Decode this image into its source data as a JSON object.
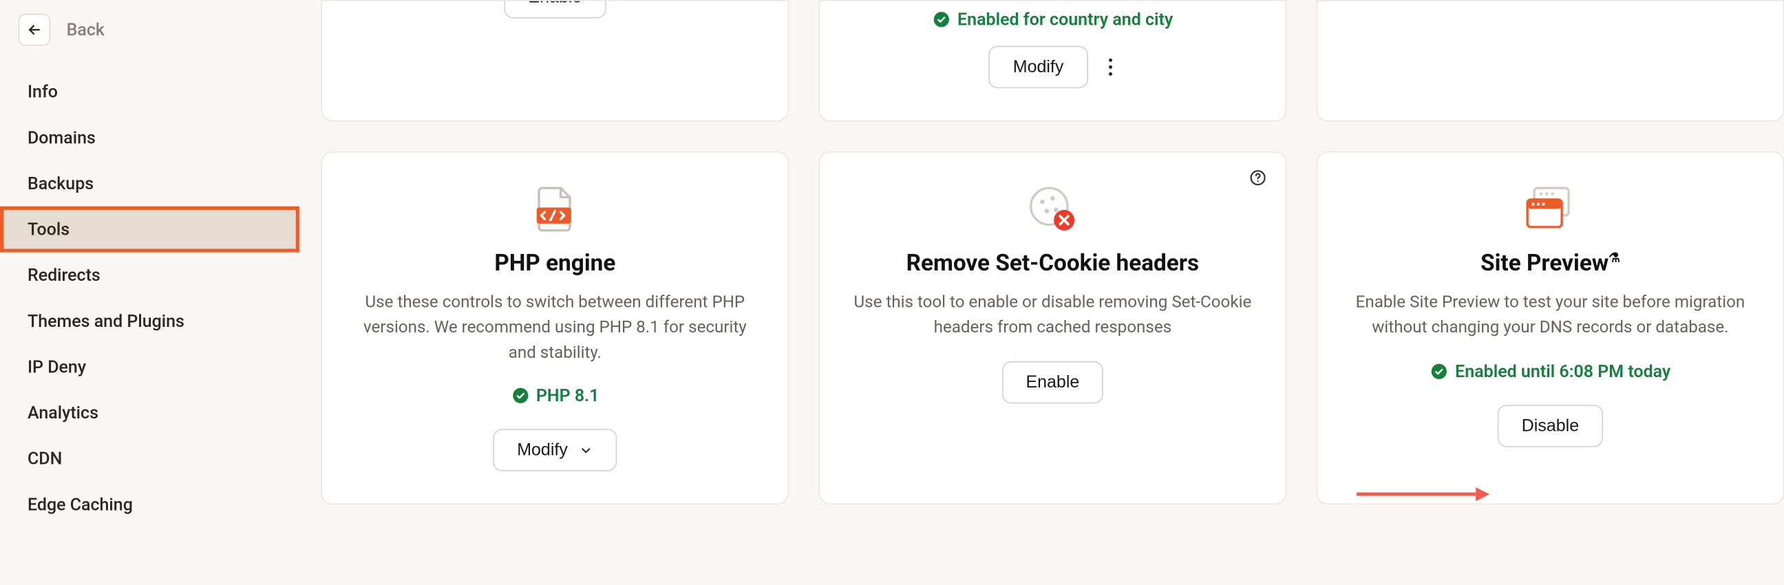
{
  "back_label": "Back",
  "sidebar": {
    "items": [
      {
        "label": "Info"
      },
      {
        "label": "Domains"
      },
      {
        "label": "Backups"
      },
      {
        "label": "Tools",
        "active": true
      },
      {
        "label": "Redirects"
      },
      {
        "label": "Themes and Plugins"
      },
      {
        "label": "IP Deny"
      },
      {
        "label": "Analytics"
      },
      {
        "label": "CDN"
      },
      {
        "label": "Edge Caching"
      }
    ]
  },
  "row1": {
    "card1": {
      "button": "Enable"
    },
    "card2": {
      "status": "Enabled for country and city",
      "button": "Modify"
    },
    "card3": {}
  },
  "cards": {
    "php": {
      "title": "PHP engine",
      "desc": "Use these controls to switch between different PHP versions. We recommend using PHP 8.1 for security and stability.",
      "status": "PHP 8.1",
      "button": "Modify"
    },
    "cookie": {
      "title": "Remove Set-Cookie headers",
      "desc": "Use this tool to enable or disable removing Set-Cookie headers from cached responses",
      "button": "Enable"
    },
    "preview": {
      "title": "Site Preview",
      "desc": "Enable Site Preview to test your site before migration without changing your DNS records or database.",
      "status": "Enabled until 6:08 PM today",
      "button": "Disable"
    }
  }
}
